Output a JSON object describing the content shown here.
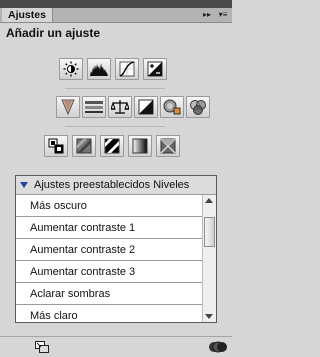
{
  "panel": {
    "tab_label": "Ajustes",
    "title": "Añadir un ajuste"
  },
  "icons": {
    "row1": [
      "brightness-contrast-icon",
      "levels-icon",
      "curves-icon",
      "exposure-icon"
    ],
    "row2": [
      "vibrance-icon",
      "hue-saturation-icon",
      "color-balance-icon",
      "black-white-icon",
      "photo-filter-icon",
      "channel-mixer-icon"
    ],
    "row3": [
      "invert-icon",
      "posterize-icon",
      "threshold-icon",
      "gradient-map-icon",
      "selective-color-icon"
    ]
  },
  "presets": {
    "header": "Ajustes preestablecidos Niveles",
    "items": [
      "Más oscuro",
      "Aumentar contraste 1",
      "Aumentar contraste 2",
      "Aumentar contraste 3",
      "Aclarar sombras",
      "Más claro"
    ]
  }
}
